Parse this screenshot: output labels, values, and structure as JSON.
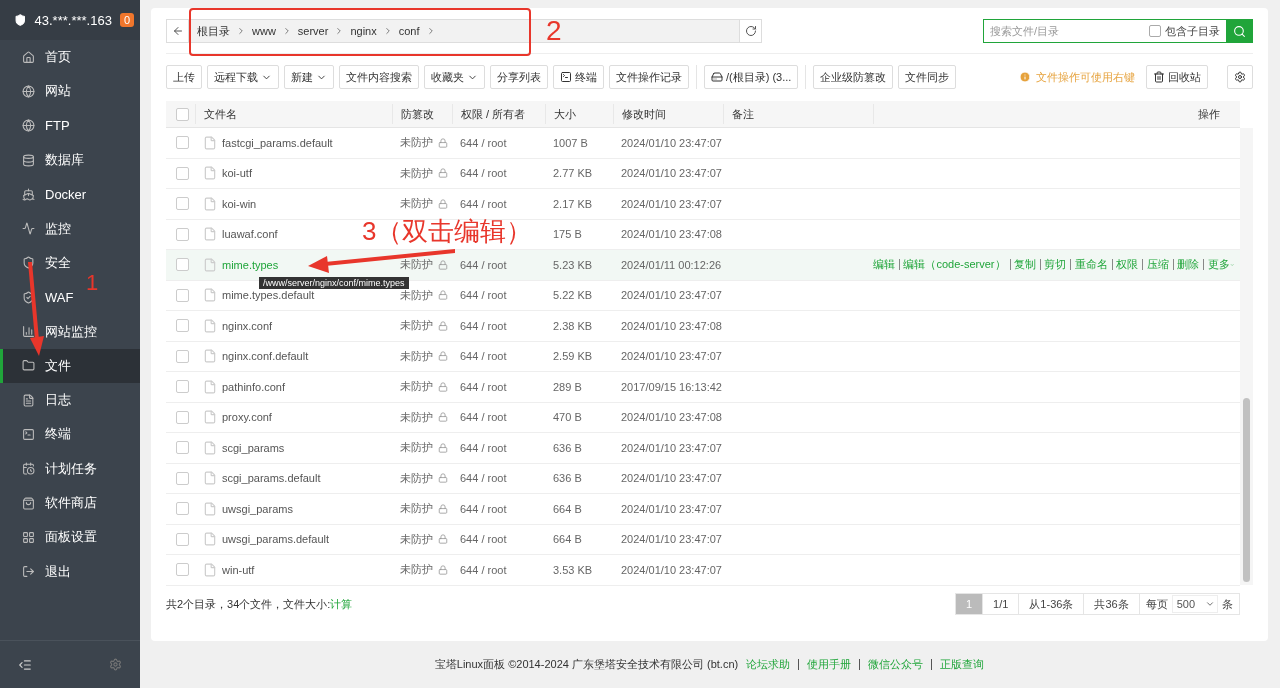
{
  "sidebar": {
    "host": "43.***.***.163",
    "badge": "0",
    "items": [
      {
        "label": "首页",
        "selected": false
      },
      {
        "label": "网站",
        "selected": false
      },
      {
        "label": "FTP",
        "selected": false
      },
      {
        "label": "数据库",
        "selected": false
      },
      {
        "label": "Docker",
        "selected": false
      },
      {
        "label": "监控",
        "selected": false
      },
      {
        "label": "安全",
        "selected": false
      },
      {
        "label": "WAF",
        "selected": false
      },
      {
        "label": "网站监控",
        "selected": false
      },
      {
        "label": "文件",
        "selected": true
      },
      {
        "label": "日志",
        "selected": false
      },
      {
        "label": "终端",
        "selected": false
      },
      {
        "label": "计划任务",
        "selected": false
      },
      {
        "label": "软件商店",
        "selected": false
      },
      {
        "label": "面板设置",
        "selected": false
      },
      {
        "label": "退出",
        "selected": false
      }
    ]
  },
  "path_bar": {
    "crumbs": [
      "根目录",
      "www",
      "server",
      "nginx",
      "conf"
    ]
  },
  "search": {
    "placeholder": "搜索文件/目录",
    "include_subdirs": {
      "label": "包含子目录",
      "checked": false
    }
  },
  "toolbar": {
    "buttons": [
      {
        "label": "上传",
        "kind": "plain"
      },
      {
        "label": "远程下载",
        "kind": "dropdown"
      },
      {
        "label": "新建",
        "kind": "dropdown"
      },
      {
        "label": "文件内容搜索",
        "kind": "plain"
      },
      {
        "label": "收藏夹",
        "kind": "dropdown"
      },
      {
        "label": "分享列表",
        "kind": "plain"
      },
      {
        "label": "终端",
        "kind": "terminal"
      },
      {
        "label": "文件操作记录",
        "kind": "plain"
      },
      {
        "label": "/(根目录) (3...",
        "kind": "disk"
      },
      {
        "label": "企业级防篡改",
        "kind": "plain"
      },
      {
        "label": "文件同步",
        "kind": "plain"
      }
    ],
    "tip": "文件操作可使用右键",
    "recycle": "回收站"
  },
  "table": {
    "select_all": {
      "checked": false
    },
    "columns": [
      "文件名",
      "防篡改",
      "权限 / 所有者",
      "大小",
      "修改时间",
      "备注",
      "操作"
    ],
    "row_actions": [
      "编辑",
      "编辑（code-server）",
      "复制",
      "剪切",
      "重命名",
      "权限",
      "压缩",
      "删除",
      "更多"
    ],
    "rows": [
      {
        "name": "fastcgi_params.default",
        "protect": "未防护",
        "perm": "644 / root",
        "size": "1007 B",
        "mtime": "2024/01/10 23:47:07",
        "selected": false
      },
      {
        "name": "koi-utf",
        "protect": "未防护",
        "perm": "644 / root",
        "size": "2.77 KB",
        "mtime": "2024/01/10 23:47:07",
        "selected": false
      },
      {
        "name": "koi-win",
        "protect": "未防护",
        "perm": "644 / root",
        "size": "2.17 KB",
        "mtime": "2024/01/10 23:47:07",
        "selected": false
      },
      {
        "name": "luawaf.conf",
        "size": "175 B",
        "mtime": "2024/01/10 23:47:08",
        "selected": false
      },
      {
        "name": "mime.types",
        "protect": "未防护",
        "perm": "644 / root",
        "size": "5.23 KB",
        "mtime": "2024/01/11 00:12:26",
        "selected": true
      },
      {
        "name": "mime.types.default",
        "protect": "未防护",
        "perm": "644 / root",
        "size": "5.22 KB",
        "mtime": "2024/01/10 23:47:07",
        "selected": false
      },
      {
        "name": "nginx.conf",
        "protect": "未防护",
        "perm": "644 / root",
        "size": "2.38 KB",
        "mtime": "2024/01/10 23:47:08",
        "selected": false
      },
      {
        "name": "nginx.conf.default",
        "protect": "未防护",
        "perm": "644 / root",
        "size": "2.59 KB",
        "mtime": "2024/01/10 23:47:07",
        "selected": false
      },
      {
        "name": "pathinfo.conf",
        "protect": "未防护",
        "perm": "644 / root",
        "size": "289 B",
        "mtime": "2017/09/15 16:13:42",
        "selected": false
      },
      {
        "name": "proxy.conf",
        "protect": "未防护",
        "perm": "644 / root",
        "size": "470 B",
        "mtime": "2024/01/10 23:47:08",
        "selected": false
      },
      {
        "name": "scgi_params",
        "protect": "未防护",
        "perm": "644 / root",
        "size": "636 B",
        "mtime": "2024/01/10 23:47:07",
        "selected": false
      },
      {
        "name": "scgi_params.default",
        "protect": "未防护",
        "perm": "644 / root",
        "size": "636 B",
        "mtime": "2024/01/10 23:47:07",
        "selected": false
      },
      {
        "name": "uwsgi_params",
        "protect": "未防护",
        "perm": "644 / root",
        "size": "664 B",
        "mtime": "2024/01/10 23:47:07",
        "selected": false
      },
      {
        "name": "uwsgi_params.default",
        "protect": "未防护",
        "perm": "644 / root",
        "size": "664 B",
        "mtime": "2024/01/10 23:47:07",
        "selected": false
      },
      {
        "name": "win-utf",
        "protect": "未防护",
        "perm": "644 / root",
        "size": "3.53 KB",
        "mtime": "2024/01/10 23:47:07",
        "selected": false
      }
    ],
    "tooltip": "/www/server/nginx/conf/mime.types"
  },
  "summary": {
    "text": "共2个目录，34个文件，文件大小:",
    "link": "计算"
  },
  "pagination": {
    "pages": [
      {
        "label": "1",
        "selected": true
      }
    ],
    "page_of": "1/1",
    "range": "从1-36条",
    "total": "共36条",
    "per_page_label": "每页",
    "per_page": "500",
    "unit": "条"
  },
  "footer": {
    "copyright": "宝塔Linux面板 ©2014-2024 广东堡塔安全技术有限公司 (bt.cn)",
    "links": [
      "论坛求助",
      "使用手册",
      "微信公众号",
      "正版查询"
    ]
  },
  "annotations": [
    {
      "label": "1"
    },
    {
      "label": "2"
    },
    {
      "label": "3（双击编辑）"
    }
  ]
}
